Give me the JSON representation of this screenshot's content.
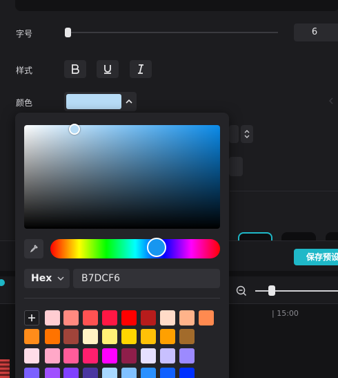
{
  "panel": {
    "font_size_label": "字号",
    "font_size_value": "6",
    "font_size_slider": 0.0,
    "style_label": "样式",
    "style_buttons": [
      "bold-icon",
      "underline-icon",
      "italic-icon"
    ],
    "color_label": "颜色",
    "current_color": "#B7DCF6"
  },
  "footer": {
    "save_label": "保存预设"
  },
  "timeline": {
    "tick_label": "| 15:00",
    "zoom_level": 0.18
  },
  "picker": {
    "format": "Hex",
    "hex_value": "B7DCF6",
    "hue_color": "#1796f0",
    "add_label": "+",
    "swatches": [
      [
        "#ffcdd2",
        "#ff8a80",
        "#ff5252",
        "#ff1744",
        "#ff0000",
        "#b71c1c",
        "#ffdbc8",
        "#ffb38a",
        "#ff8a50"
      ],
      [
        "#ff8c1a",
        "#ff7300",
        "#a0443a",
        "#fff3c4",
        "#fff176",
        "#ffd600",
        "#ffc107",
        "#ffa000",
        "#a26b2b"
      ],
      [
        "#ffdde8",
        "#ffa8c8",
        "#ff5c9a",
        "#ff1f6e",
        "#ff00ff",
        "#8e1e4a",
        "#e6e0ff",
        "#c8c0ff",
        "#9c8aff"
      ],
      [
        "#7b60ff",
        "#a050ff",
        "#8040ff",
        "#4a36a0",
        "#a8d8ff",
        "#80c0ff",
        "#2a90ff",
        "#1060ff",
        "#0030ff"
      ]
    ]
  },
  "colors": {
    "accent": "#1fb8c8",
    "panel_bg": "#1c1c1f",
    "picker_bg": "#242428"
  }
}
